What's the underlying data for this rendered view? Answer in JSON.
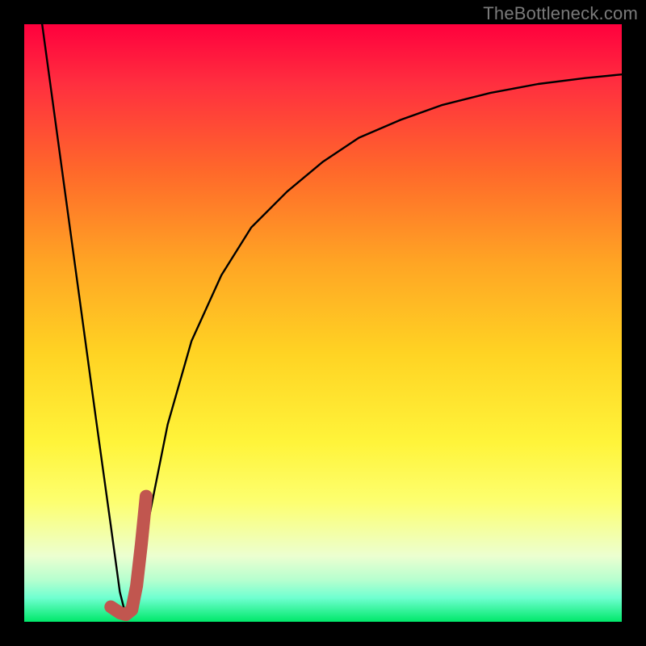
{
  "watermark": "TheBottleneck.com",
  "colors": {
    "curve": "#000000",
    "accent": "#c1564f",
    "background_top": "#ff003d",
    "background_bottom": "#00e86a",
    "frame": "#000000"
  },
  "chart_data": {
    "type": "line",
    "title": "",
    "xlabel": "",
    "ylabel": "",
    "xlim": [
      0,
      100
    ],
    "ylim": [
      0,
      100
    ],
    "grid": false,
    "legend": false,
    "series": [
      {
        "name": "bottleneck_curve",
        "x": [
          3,
          6,
          9,
          12,
          14.5,
          16,
          17,
          18,
          19,
          21,
          24,
          28,
          33,
          38,
          44,
          50,
          56,
          63,
          70,
          78,
          86,
          94,
          100
        ],
        "y": [
          100,
          78,
          56,
          34,
          16,
          5,
          1,
          2,
          8,
          18,
          33,
          47,
          58,
          66,
          72,
          77,
          81,
          84,
          86.5,
          88.5,
          90,
          91,
          91.6
        ]
      },
      {
        "name": "accent_segment",
        "x": [
          14.5,
          16,
          17,
          18,
          18.8,
          19.6,
          20.4
        ],
        "y": [
          2.5,
          1.5,
          1.2,
          2,
          6,
          13,
          21
        ]
      }
    ]
  }
}
